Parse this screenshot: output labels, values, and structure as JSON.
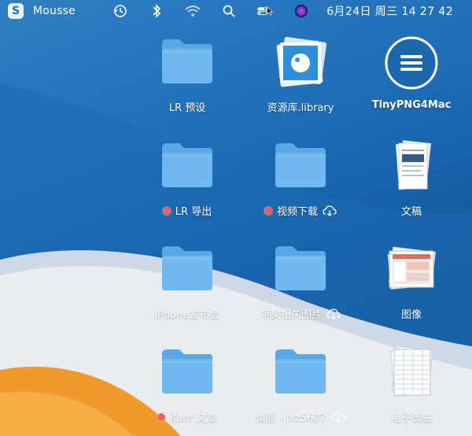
{
  "menubar": {
    "app_badge": "S",
    "app_name": "Mousse",
    "date_time": "6月24日 周三   14 27 42",
    "icons": [
      "time-machine-icon",
      "bluetooth-icon",
      "wifi-icon",
      "search-icon",
      "control-center-icon",
      "siri-icon"
    ]
  },
  "desktop": {
    "items": [
      {
        "label": "LR 预设",
        "type": "folder",
        "tag": false,
        "cloud": false
      },
      {
        "label": "资源库.library",
        "type": "library-app",
        "tag": false,
        "cloud": false
      },
      {
        "label": "TinyPNG4Mac",
        "type": "app",
        "tag": false,
        "cloud": false
      },
      {
        "label": "LR 导出",
        "type": "folder",
        "tag": true,
        "cloud": false
      },
      {
        "label": "视频下载",
        "type": "folder",
        "tag": true,
        "cloud": true
      },
      {
        "label": "文稿",
        "type": "document-stack",
        "tag": false,
        "cloud": false
      },
      {
        "label": "iPhone发布会",
        "type": "folder",
        "tag": false,
        "cloud": false
      },
      {
        "label": "苹果相关图片",
        "type": "folder",
        "tag": false,
        "cloud": true
      },
      {
        "label": "图像",
        "type": "image-stack",
        "tag": false,
        "cloud": false
      },
      {
        "label": "ifanr 文章",
        "type": "folder",
        "tag": true,
        "cloud": false
      },
      {
        "label": "桌面 - lxz5607",
        "type": "folder",
        "tag": false,
        "cloud": true
      },
      {
        "label": "电子表格",
        "type": "spreadsheet-stack",
        "tag": false,
        "cloud": false
      }
    ]
  },
  "colors": {
    "tag_red": "#ff5b5b",
    "folder_blue": "#61b0ec",
    "wallpaper_blue": "#1f6eb8"
  }
}
